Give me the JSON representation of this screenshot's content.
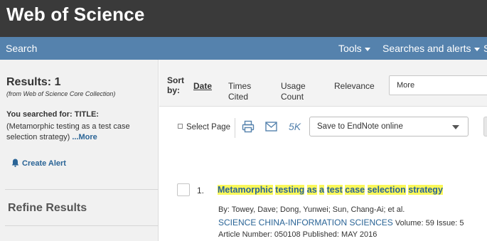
{
  "brand": {
    "title": "Web of Science"
  },
  "nav": {
    "search": "Search",
    "tools": "Tools",
    "searches_alerts": "Searches and alerts",
    "cut_item": "S"
  },
  "sidebar": {
    "results_count": "Results: 1",
    "results_source": "(from Web of Science Core Collection)",
    "searched_label": "You searched for: TITLE:",
    "searched_query": "(Metamorphic testing as a test case selection strategy)",
    "more_link": "...More",
    "create_alert": "Create Alert",
    "refine_title": "Refine Results"
  },
  "sort": {
    "label": "Sort by:",
    "options": [
      "Date",
      "Times Cited",
      "Usage Count",
      "Relevance"
    ],
    "more_select": "More"
  },
  "toolbar": {
    "select_page": "Select Page",
    "count_label": "5K",
    "endnote_select": "Save to EndNote online"
  },
  "record": {
    "number": "1.",
    "title_words": [
      "Metamorphic",
      "testing",
      "as",
      "a",
      "test",
      "case",
      "selection",
      "strategy"
    ],
    "authors": "By: Towey, Dave; Dong, Yunwei; Sun, Chang-Ai; et al.",
    "journal": "SCIENCE CHINA-INFORMATION SCIENCES",
    "details": "Volume: 59   Issue: 5   Article Number: 050108   Published: MAY 2016"
  },
  "colors": {
    "top_bar": "#3a3a3a",
    "nav_bar": "#5582ad",
    "link": "#2a6496",
    "highlight": "#faf75a"
  },
  "icons": [
    "bell-icon",
    "print-icon",
    "email-icon",
    "caret-down-icon"
  ]
}
